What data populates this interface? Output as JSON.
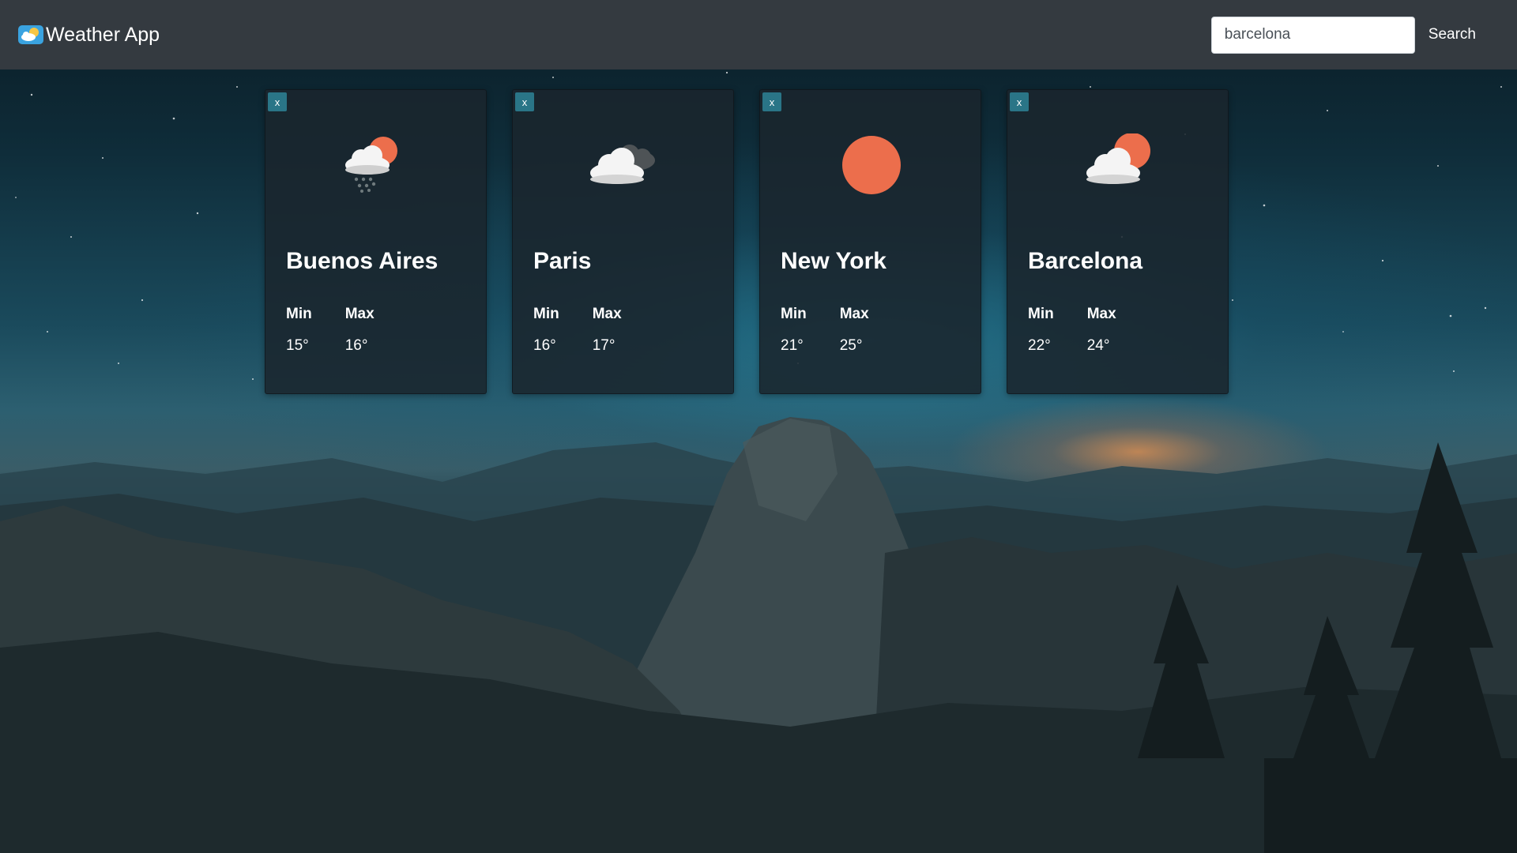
{
  "app": {
    "title": "Weather App",
    "logo_icon": "weather-cloud-sun-icon"
  },
  "search": {
    "value": "barcelona",
    "placeholder": "",
    "button_label": "Search"
  },
  "colors": {
    "navbar": "#343a40",
    "sun": "#ec6e4c",
    "close_button": "#2a7587"
  },
  "cards": [
    {
      "close_label": "x",
      "city": "Buenos Aires",
      "icon": "rain-cloud-sun-icon",
      "min_label": "Min",
      "max_label": "Max",
      "min": "15°",
      "max": "16°"
    },
    {
      "close_label": "x",
      "city": "Paris",
      "icon": "cloudy-icon",
      "min_label": "Min",
      "max_label": "Max",
      "min": "16°",
      "max": "17°"
    },
    {
      "close_label": "x",
      "city": "New York",
      "icon": "sun-icon",
      "min_label": "Min",
      "max_label": "Max",
      "min": "21°",
      "max": "25°"
    },
    {
      "close_label": "x",
      "city": "Barcelona",
      "icon": "partly-cloudy-icon",
      "min_label": "Min",
      "max_label": "Max",
      "min": "22°",
      "max": "24°"
    }
  ]
}
